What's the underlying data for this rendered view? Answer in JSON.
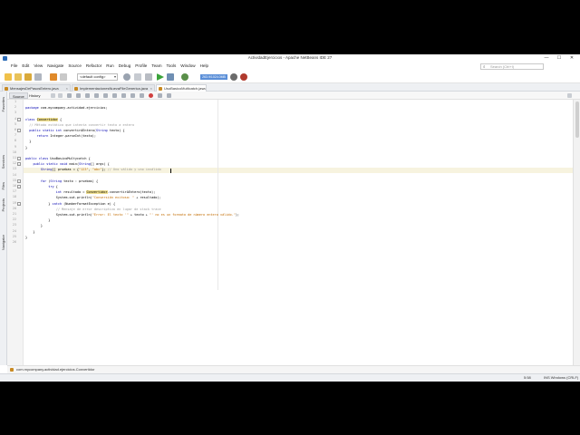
{
  "window": {
    "title": "ActividadEjercicios - Apache NetBeans IDE 27",
    "minimize": "—",
    "maximize": "☐",
    "close": "✕"
  },
  "menu": [
    "File",
    "Edit",
    "View",
    "Navigate",
    "Source",
    "Refactor",
    "Run",
    "Debug",
    "Profile",
    "Team",
    "Tools",
    "Window",
    "Help"
  ],
  "search": {
    "placeholder": "Search (Ctrl+I)"
  },
  "toolbar": {
    "config_value": "<default config>",
    "memory_label": "263.9/1024.0MB"
  },
  "tabs": [
    {
      "label": "MensajesDePasosEntero.java",
      "active": false
    },
    {
      "label": "ImplementacionesNuevaFileGenerica.java",
      "active": false
    },
    {
      "label": "UsoBasicoMulticatch.java",
      "active": true
    }
  ],
  "side_panels": [
    "Favorites",
    "Services",
    "Files",
    "Projects",
    "Navigator"
  ],
  "editor_bar": {
    "source": "Source",
    "history": "History"
  },
  "lines": [
    {
      "n": "1",
      "text": ""
    },
    {
      "n": "2",
      "text": "package com.mycompany.actividad.ejercicios;"
    },
    {
      "n": "3",
      "text": ""
    },
    {
      "n": "4",
      "text": "class Convertidor {"
    },
    {
      "n": "5",
      "text": "  // Método estático que intenta convertir texto a entero"
    },
    {
      "n": "6",
      "text": "  public static int convertirAEntero(String texto) {"
    },
    {
      "n": "7",
      "text": "      return Integer.parseInt(texto);"
    },
    {
      "n": "8",
      "text": "  }"
    },
    {
      "n": "9",
      "text": "}"
    },
    {
      "n": "10",
      "text": ""
    },
    {
      "n": "11",
      "text": "public class UsoBasicoMultycatch {"
    },
    {
      "n": "12",
      "text": "    public static void main(String[] args) {"
    },
    {
      "n": "13",
      "text": "        String[] pruebas = {\"123\", \"abc\"}; // Uno válido y uno inválido"
    },
    {
      "n": "14",
      "text": ""
    },
    {
      "n": "15",
      "text": "        for (String texto : pruebas) {"
    },
    {
      "n": "16",
      "text": "            try {"
    },
    {
      "n": "17",
      "text": "                int resultado = Convertidor.convertirAEntero(texto);"
    },
    {
      "n": "18",
      "text": "                System.out.println(\"Conversión exitosa: \" + resultado);"
    },
    {
      "n": "19",
      "text": "            } catch (NumberFormatException e) {"
    },
    {
      "n": "20",
      "text": "                // Mensaje de error descriptivo en lugar de stack trace"
    },
    {
      "n": "21",
      "text": "                System.out.println(\"Error: El texto '\" + texto + \"' no es un formato de número entero válido.\");"
    },
    {
      "n": "22",
      "text": "            }"
    },
    {
      "n": "23",
      "text": "        }"
    },
    {
      "n": "24",
      "text": "    }"
    },
    {
      "n": "25",
      "text": "}"
    },
    {
      "n": "26",
      "text": ""
    }
  ],
  "breadcrumb": "com.mycompany.actividad.ejercicios.Convertidor",
  "status": {
    "position": "5:58",
    "mode": "INS Windows (CRLF)"
  },
  "colors": {
    "keyword": "#0000b0",
    "comment": "#9a9a9a",
    "string": "#c26b00",
    "current_line": "#f7f3df"
  }
}
